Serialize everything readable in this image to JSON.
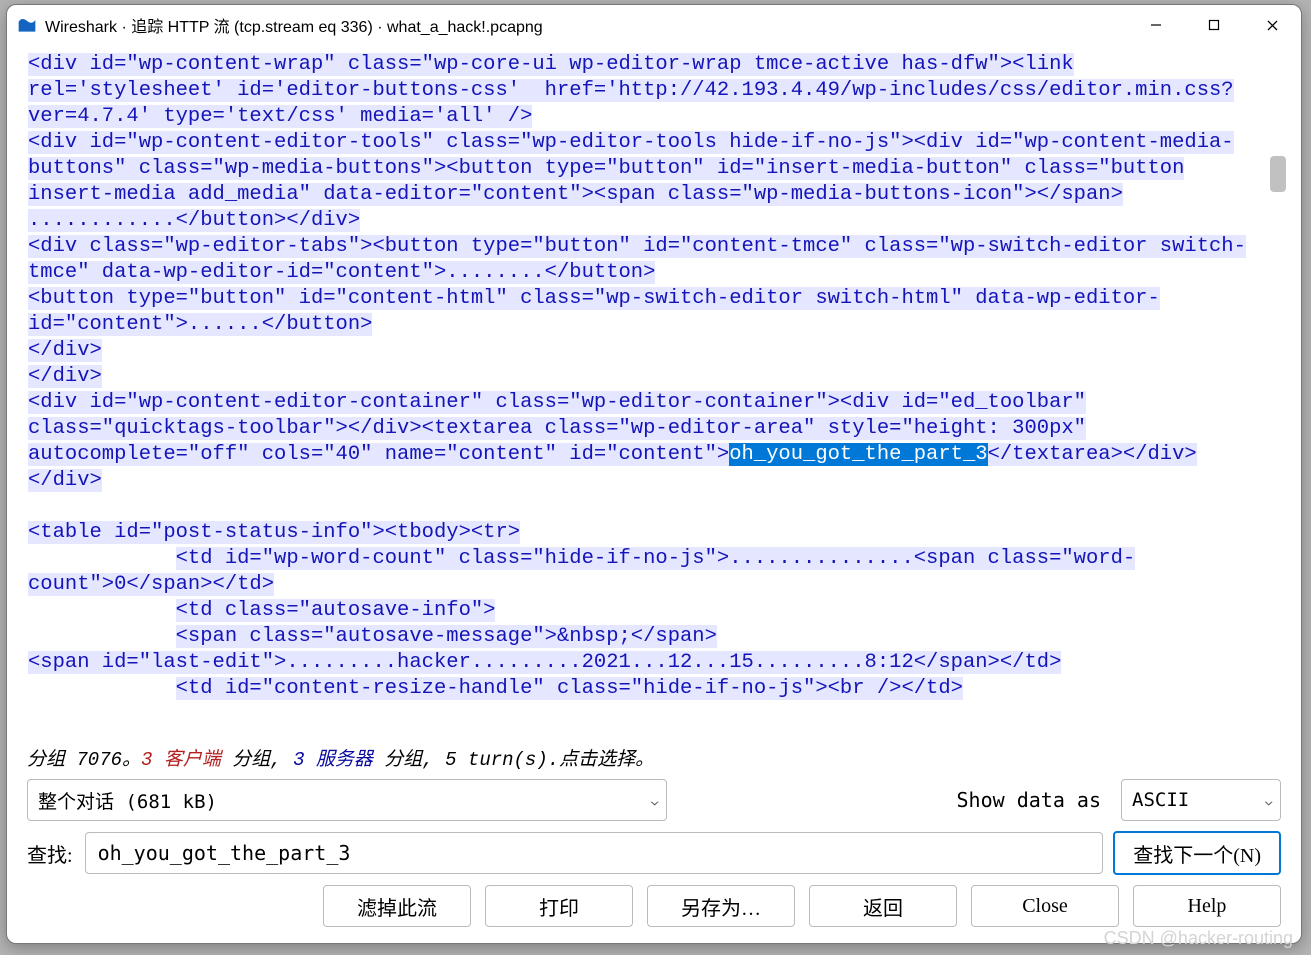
{
  "title": "Wireshark · 追踪 HTTP 流 (tcp.stream eq 336) · what_a_hack!.pcapng",
  "stream": {
    "lines": [
      {
        "pre": "",
        "hl": "<div id=\"wp-content-wrap\" class=\"wp-core-ui wp-editor-wrap tmce-active has-dfw\"><link"
      },
      {
        "pre": "",
        "hl": "rel='stylesheet' id='editor-buttons-css'  href='http://42.193.4.49/wp-includes/css/editor.min.css?"
      },
      {
        "pre": "",
        "hl": "ver=4.7.4' type='text/css' media='all' />"
      },
      {
        "pre": "",
        "hl": "<div id=\"wp-content-editor-tools\" class=\"wp-editor-tools hide-if-no-js\"><div id=\"wp-content-media-"
      },
      {
        "pre": "",
        "hl": "buttons\" class=\"wp-media-buttons\"><button type=\"button\" id=\"insert-media-button\" class=\"button"
      },
      {
        "pre": "",
        "hl": "insert-media add_media\" data-editor=\"content\"><span class=\"wp-media-buttons-icon\"></span>"
      },
      {
        "pre": "",
        "hl": "............</button></div>"
      },
      {
        "pre": "",
        "hl": "<div class=\"wp-editor-tabs\"><button type=\"button\" id=\"content-tmce\" class=\"wp-switch-editor switch-"
      },
      {
        "pre": "",
        "hl": "tmce\" data-wp-editor-id=\"content\">........</button>"
      },
      {
        "pre": "",
        "hl": "<button type=\"button\" id=\"content-html\" class=\"wp-switch-editor switch-html\" data-wp-editor-"
      },
      {
        "pre": "",
        "hl": "id=\"content\">......</button>"
      },
      {
        "pre": "",
        "hl": "</div>"
      },
      {
        "pre": "",
        "hl": "</div>"
      },
      {
        "pre": "",
        "hl": "<div id=\"wp-content-editor-container\" class=\"wp-editor-container\"><div id=\"ed_toolbar\""
      },
      {
        "pre": "",
        "hl": "class=\"quicktags-toolbar\"></div><textarea class=\"wp-editor-area\" style=\"height: 300px\""
      },
      {
        "pre": "",
        "hl": "autocomplete=\"off\" cols=\"40\" name=\"content\" id=\"content\">",
        "sel": "oh_you_got_the_part_3",
        "post": "</textarea></div>"
      },
      {
        "pre": "",
        "hl": "</div>"
      },
      {
        "pre": "",
        "hl": ""
      },
      {
        "pre": "",
        "hl": "<table id=\"post-status-info\"><tbody><tr>"
      },
      {
        "pre": "            ",
        "hl": "<td id=\"wp-word-count\" class=\"hide-if-no-js\">...............<span class=\"word-"
      },
      {
        "pre": "",
        "hl": "count\">0</span></td>"
      },
      {
        "pre": "            ",
        "hl": "<td class=\"autosave-info\">"
      },
      {
        "pre": "            ",
        "hl": "<span class=\"autosave-message\">&nbsp;</span>"
      },
      {
        "pre": "",
        "hl": "<span id=\"last-edit\">.........hacker.........2021...12...15.........8:12</span></td>"
      },
      {
        "pre": "            ",
        "hl": "<td id=\"content-resize-handle\" class=\"hide-if-no-js\"><br /></td>"
      }
    ]
  },
  "status": {
    "prefix": "分组 7076。",
    "client_count": "3 ",
    "client_label": "客户端",
    "mid1": " 分组, ",
    "server_count": "3 ",
    "server_label": "服务器",
    "mid2": " 分组, ",
    "turns": "5 turn(s).",
    "click": "点击选择。"
  },
  "convo_combo": "整个对话 (681 kB)",
  "show_as_label": "Show data as",
  "encoding_combo": "ASCII",
  "find_label": "查找:",
  "find_value": "oh_you_got_the_part_3",
  "find_next": "查找下一个(N)",
  "buttons": {
    "filter_out": "滤掉此流",
    "print": "打印",
    "save_as": "另存为…",
    "back": "返回",
    "close": "Close",
    "help": "Help"
  },
  "watermark": "CSDN @hacker-routing"
}
